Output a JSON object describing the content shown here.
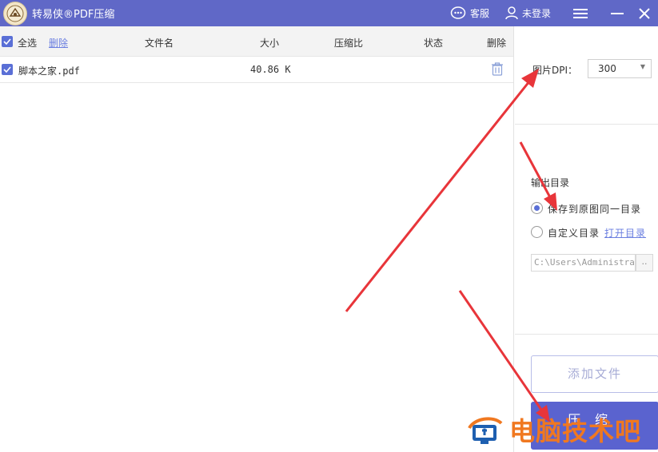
{
  "titlebar": {
    "app_title": "转易侠®PDF压缩",
    "customer_service": "客服",
    "login": "未登录"
  },
  "table": {
    "select_all": "全选",
    "delete_link": "删除",
    "headers": {
      "filename": "文件名",
      "size": "大小",
      "ratio": "压缩比",
      "status": "状态",
      "delete": "删除"
    },
    "rows": [
      {
        "filename": "脚本之家.pdf",
        "size": "40.86 K",
        "ratio": "",
        "status": "",
        "checked": true
      }
    ]
  },
  "settings": {
    "dpi_label": "图片DPI：",
    "dpi_value": "300",
    "output_title": "输出目录",
    "option_same": "保存到原图同一目录",
    "option_custom": "自定义目录",
    "open_dir": "打开目录",
    "path_value": "C:\\Users\\Administrator",
    "browse": "..",
    "selected_option": "same"
  },
  "actions": {
    "add_file": "添加文件",
    "compress": "压缩"
  },
  "watermark": {
    "text": "电脑技术吧"
  },
  "colors": {
    "accent": "#6068c7",
    "checkbox": "#5a6fd6",
    "annotation_arrow": "#e8353a",
    "watermark": "#f07820"
  }
}
